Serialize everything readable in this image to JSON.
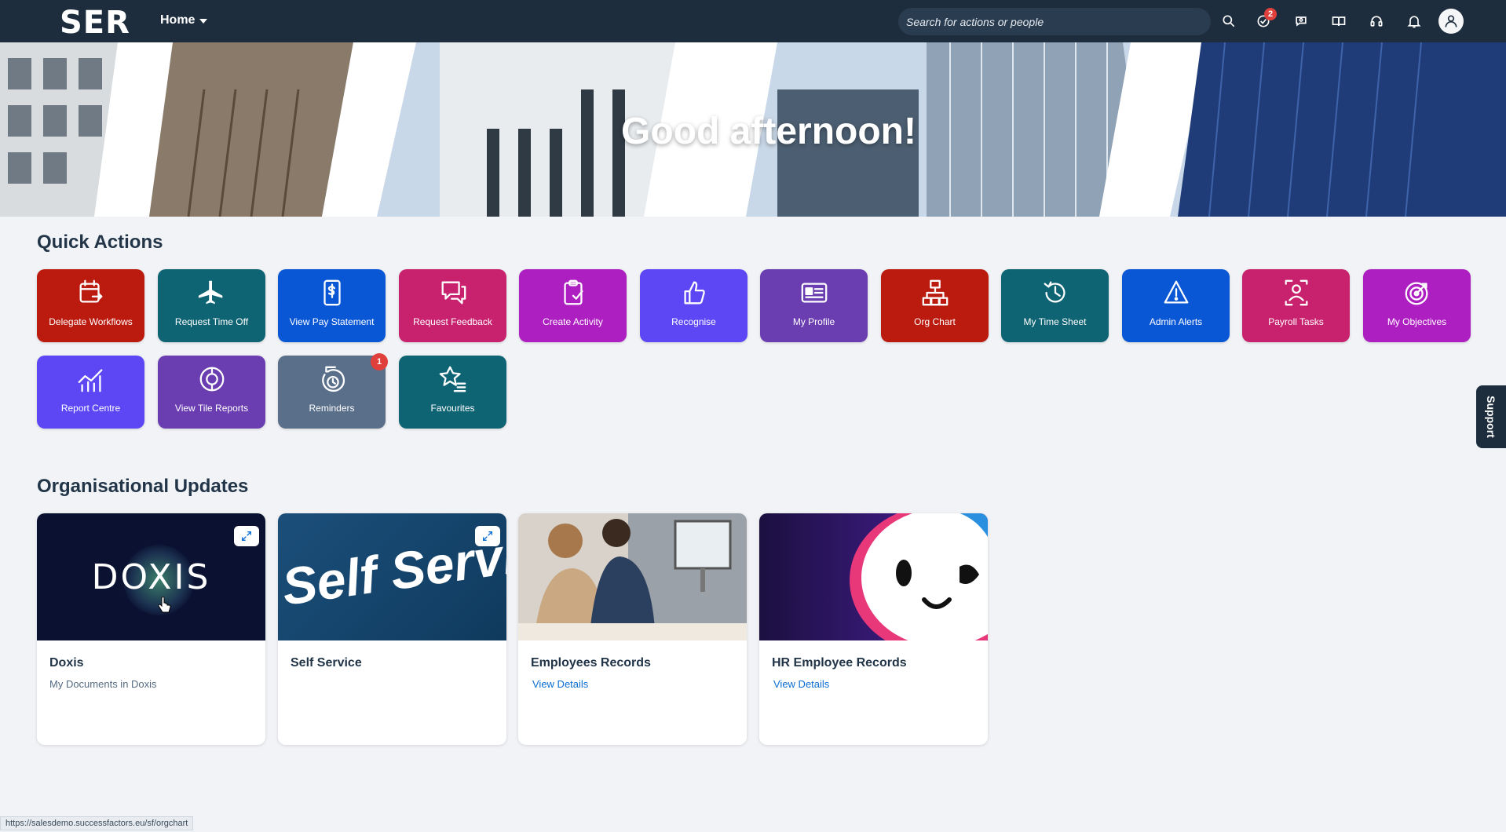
{
  "header": {
    "logo": "SER",
    "home_label": "Home",
    "search_placeholder": "Search for actions or people",
    "todo_badge": "2",
    "icons": [
      "search-icon",
      "todo-icon",
      "chat-icon",
      "book-icon",
      "headset-icon",
      "bell-icon",
      "avatar-icon"
    ]
  },
  "hero": {
    "greeting": "Good afternoon!"
  },
  "quick_actions": {
    "title": "Quick Actions",
    "tiles": [
      {
        "label": "Delegate Workflows",
        "icon": "calendar-arrow-icon",
        "color": "#bb1a0f"
      },
      {
        "label": "Request Time Off",
        "icon": "airplane-icon",
        "color": "#0f6474"
      },
      {
        "label": "View Pay Statement",
        "icon": "pay-statement-icon",
        "color": "#0a57d6"
      },
      {
        "label": "Request Feedback",
        "icon": "feedback-icon",
        "color": "#c8226f"
      },
      {
        "label": "Create Activity",
        "icon": "clipboard-check-icon",
        "color": "#ae1fc1"
      },
      {
        "label": "Recognise",
        "icon": "thumbs-up-icon",
        "color": "#5d47f5"
      },
      {
        "label": "My Profile",
        "icon": "id-card-icon",
        "color": "#6a3db0"
      },
      {
        "label": "Org Chart",
        "icon": "org-chart-icon",
        "color": "#bb1a0f"
      },
      {
        "label": "My Time Sheet",
        "icon": "history-icon",
        "color": "#0f6474"
      },
      {
        "label": "Admin Alerts",
        "icon": "alert-triangle-icon",
        "color": "#0a57d6"
      },
      {
        "label": "Payroll Tasks",
        "icon": "payroll-icon",
        "color": "#c8226f"
      },
      {
        "label": "My Objectives",
        "icon": "target-icon",
        "color": "#ae1fc1"
      },
      {
        "label": "Report Centre",
        "icon": "line-chart-icon",
        "color": "#5d47f5"
      },
      {
        "label": "View Tile Reports",
        "icon": "tile-report-icon",
        "color": "#6a3db0"
      },
      {
        "label": "Reminders",
        "icon": "reminder-icon",
        "color": "#5a6f8a",
        "badge": "1"
      },
      {
        "label": "Favourites",
        "icon": "star-list-icon",
        "color": "#0f6474"
      }
    ]
  },
  "org_updates": {
    "title": "Organisational Updates",
    "cards": [
      {
        "title": "Doxis",
        "subtitle": "My Documents in Doxis",
        "image_text": "DOXIS"
      },
      {
        "title": "Self Service",
        "image_text": "Self Service"
      },
      {
        "title": "Employees Records",
        "link": "View Details"
      },
      {
        "title": "HR Employee Records",
        "link": "View Details"
      }
    ]
  },
  "support_label": "Support",
  "status_url": "https://salesdemo.successfactors.eu/sf/orgchart",
  "colors": {
    "shell": "#1d2d3e",
    "background": "#f1f3f6",
    "link": "#0a6ed1"
  }
}
